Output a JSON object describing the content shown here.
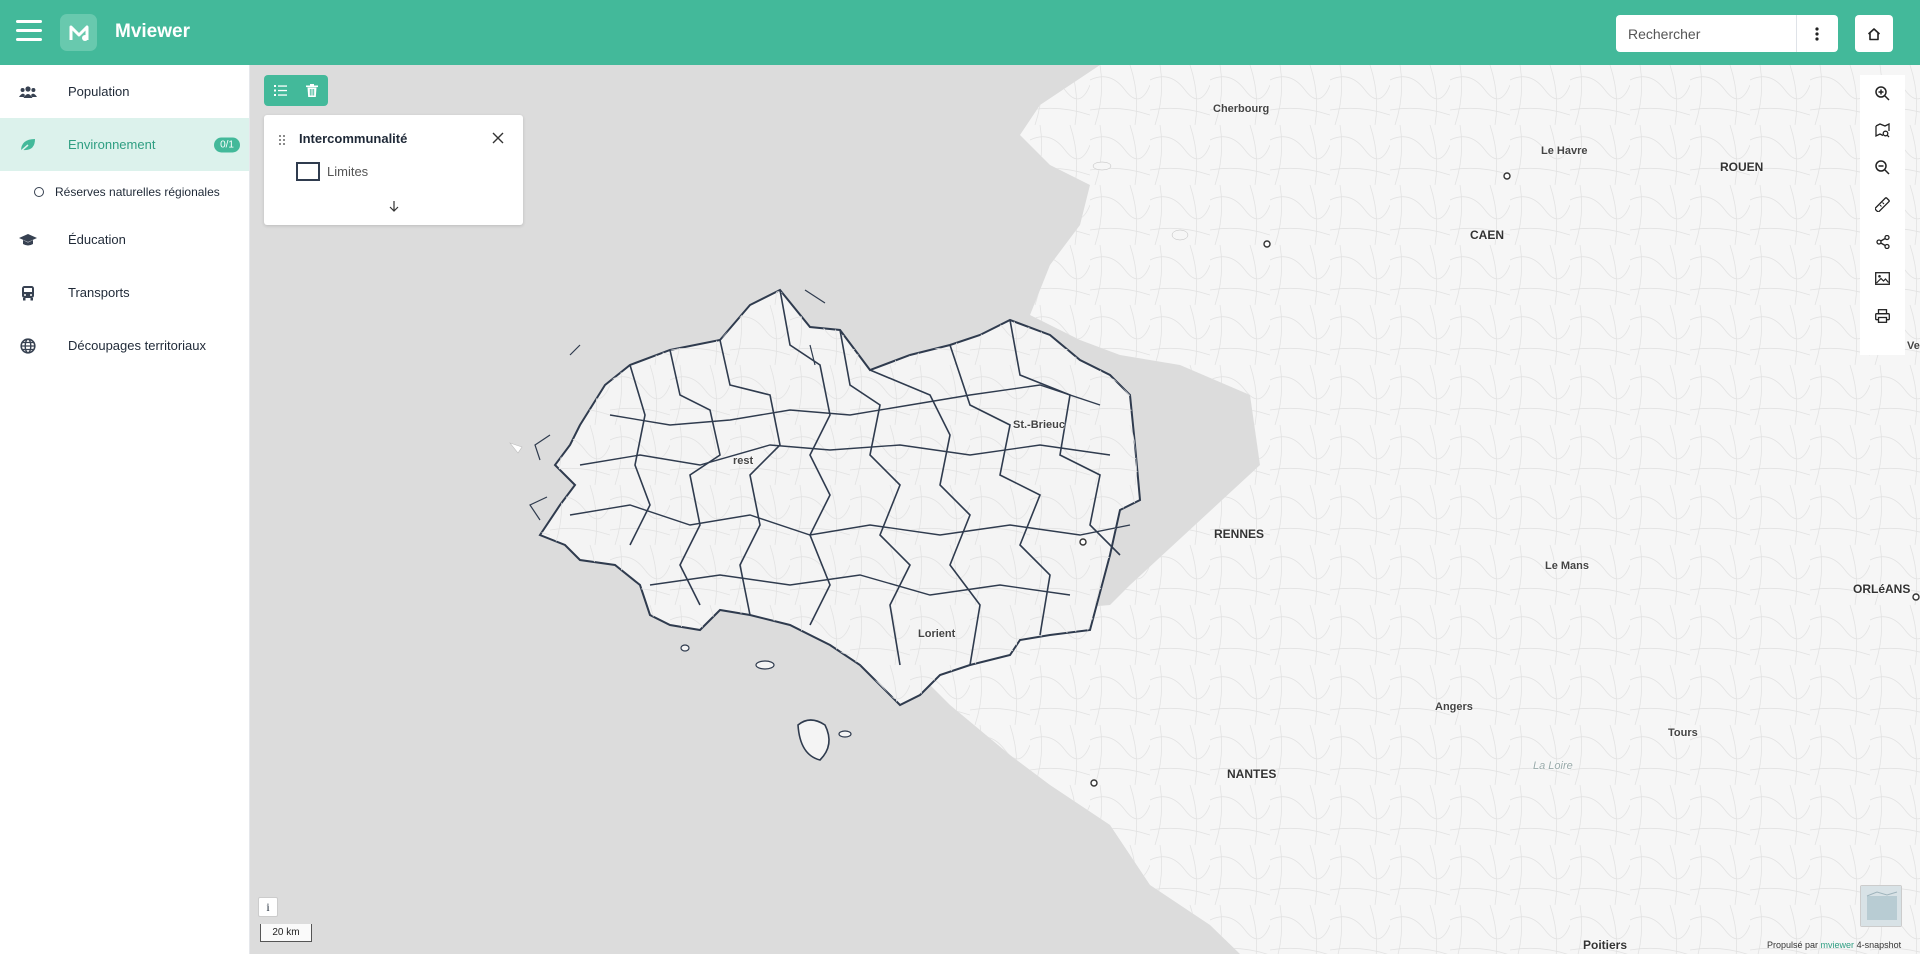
{
  "header": {
    "app_title": "Mviewer",
    "search_placeholder": "Rechercher"
  },
  "sidebar": {
    "items": [
      {
        "label": "Population",
        "icon": "users-icon"
      },
      {
        "label": "Environnement",
        "icon": "leaf-icon",
        "badge": "0/1",
        "active": true
      },
      {
        "label": "Éducation",
        "icon": "graduation-cap-icon"
      },
      {
        "label": "Transports",
        "icon": "bus-icon"
      },
      {
        "label": "Découpages territoriaux",
        "icon": "globe-icon"
      }
    ],
    "sub_items": [
      {
        "label": "Réserves naturelles régionales"
      }
    ]
  },
  "legend": {
    "title": "Intercommunalité",
    "layer_label": "Limites"
  },
  "map": {
    "places": [
      {
        "label": "Cherbourg"
      },
      {
        "label": "Le Havre"
      },
      {
        "label": "ROUEN"
      },
      {
        "label": "CAEN"
      },
      {
        "label": "St.-Brieuc"
      },
      {
        "label": "rest"
      },
      {
        "label": "RENNES"
      },
      {
        "label": "Le Mans"
      },
      {
        "label": "ORLéANS"
      },
      {
        "label": "Lorient"
      },
      {
        "label": "Angers"
      },
      {
        "label": "Tours"
      },
      {
        "label": "NANTES"
      },
      {
        "label": "La Loire"
      },
      {
        "label": "Poitiers"
      },
      {
        "label": "Ve"
      }
    ],
    "scale_label": "20 km",
    "info_label": "i",
    "attribution_prefix": "Propulsé par",
    "attribution_link": "mviewer",
    "attribution_suffix": "4-snapshot"
  },
  "colors": {
    "brand": "#43b99a",
    "active_bg": "#dcf2ec",
    "sea": "#dcdcdc",
    "land": "#f6f6f6",
    "boundary": "#2f3b4e"
  }
}
